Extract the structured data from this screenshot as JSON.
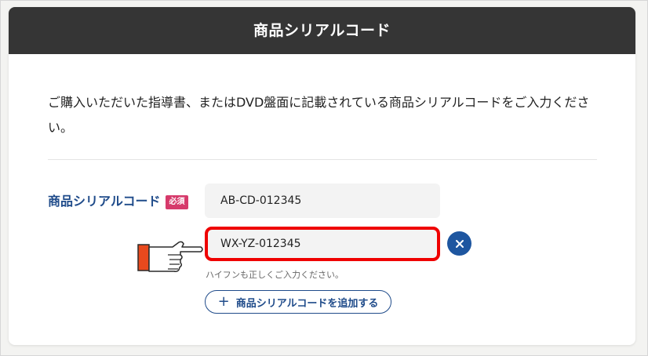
{
  "header": {
    "title": "商品シリアルコード"
  },
  "description": "ご購入いただいた指導書、またはDVD盤面に記載されている商品シリアルコードをご入力ください。",
  "form": {
    "field_label": "商品シリアルコード",
    "required_badge": "必須",
    "serial_codes": [
      "AB-CD-012345",
      "WX-YZ-012345"
    ],
    "hint": "ハイフンも正しくご入力ください。",
    "add_button_label": "商品シリアルコードを追加する"
  },
  "icons": {
    "clear": "close-icon",
    "add": "plus-icon",
    "pointer": "pointing-hand-icon"
  },
  "colors": {
    "header_bg": "#353535",
    "accent_blue": "#1f4b8a",
    "clear_button": "#1e56a0",
    "required_badge": "#d63a6b",
    "highlight_border": "#ef0000"
  }
}
